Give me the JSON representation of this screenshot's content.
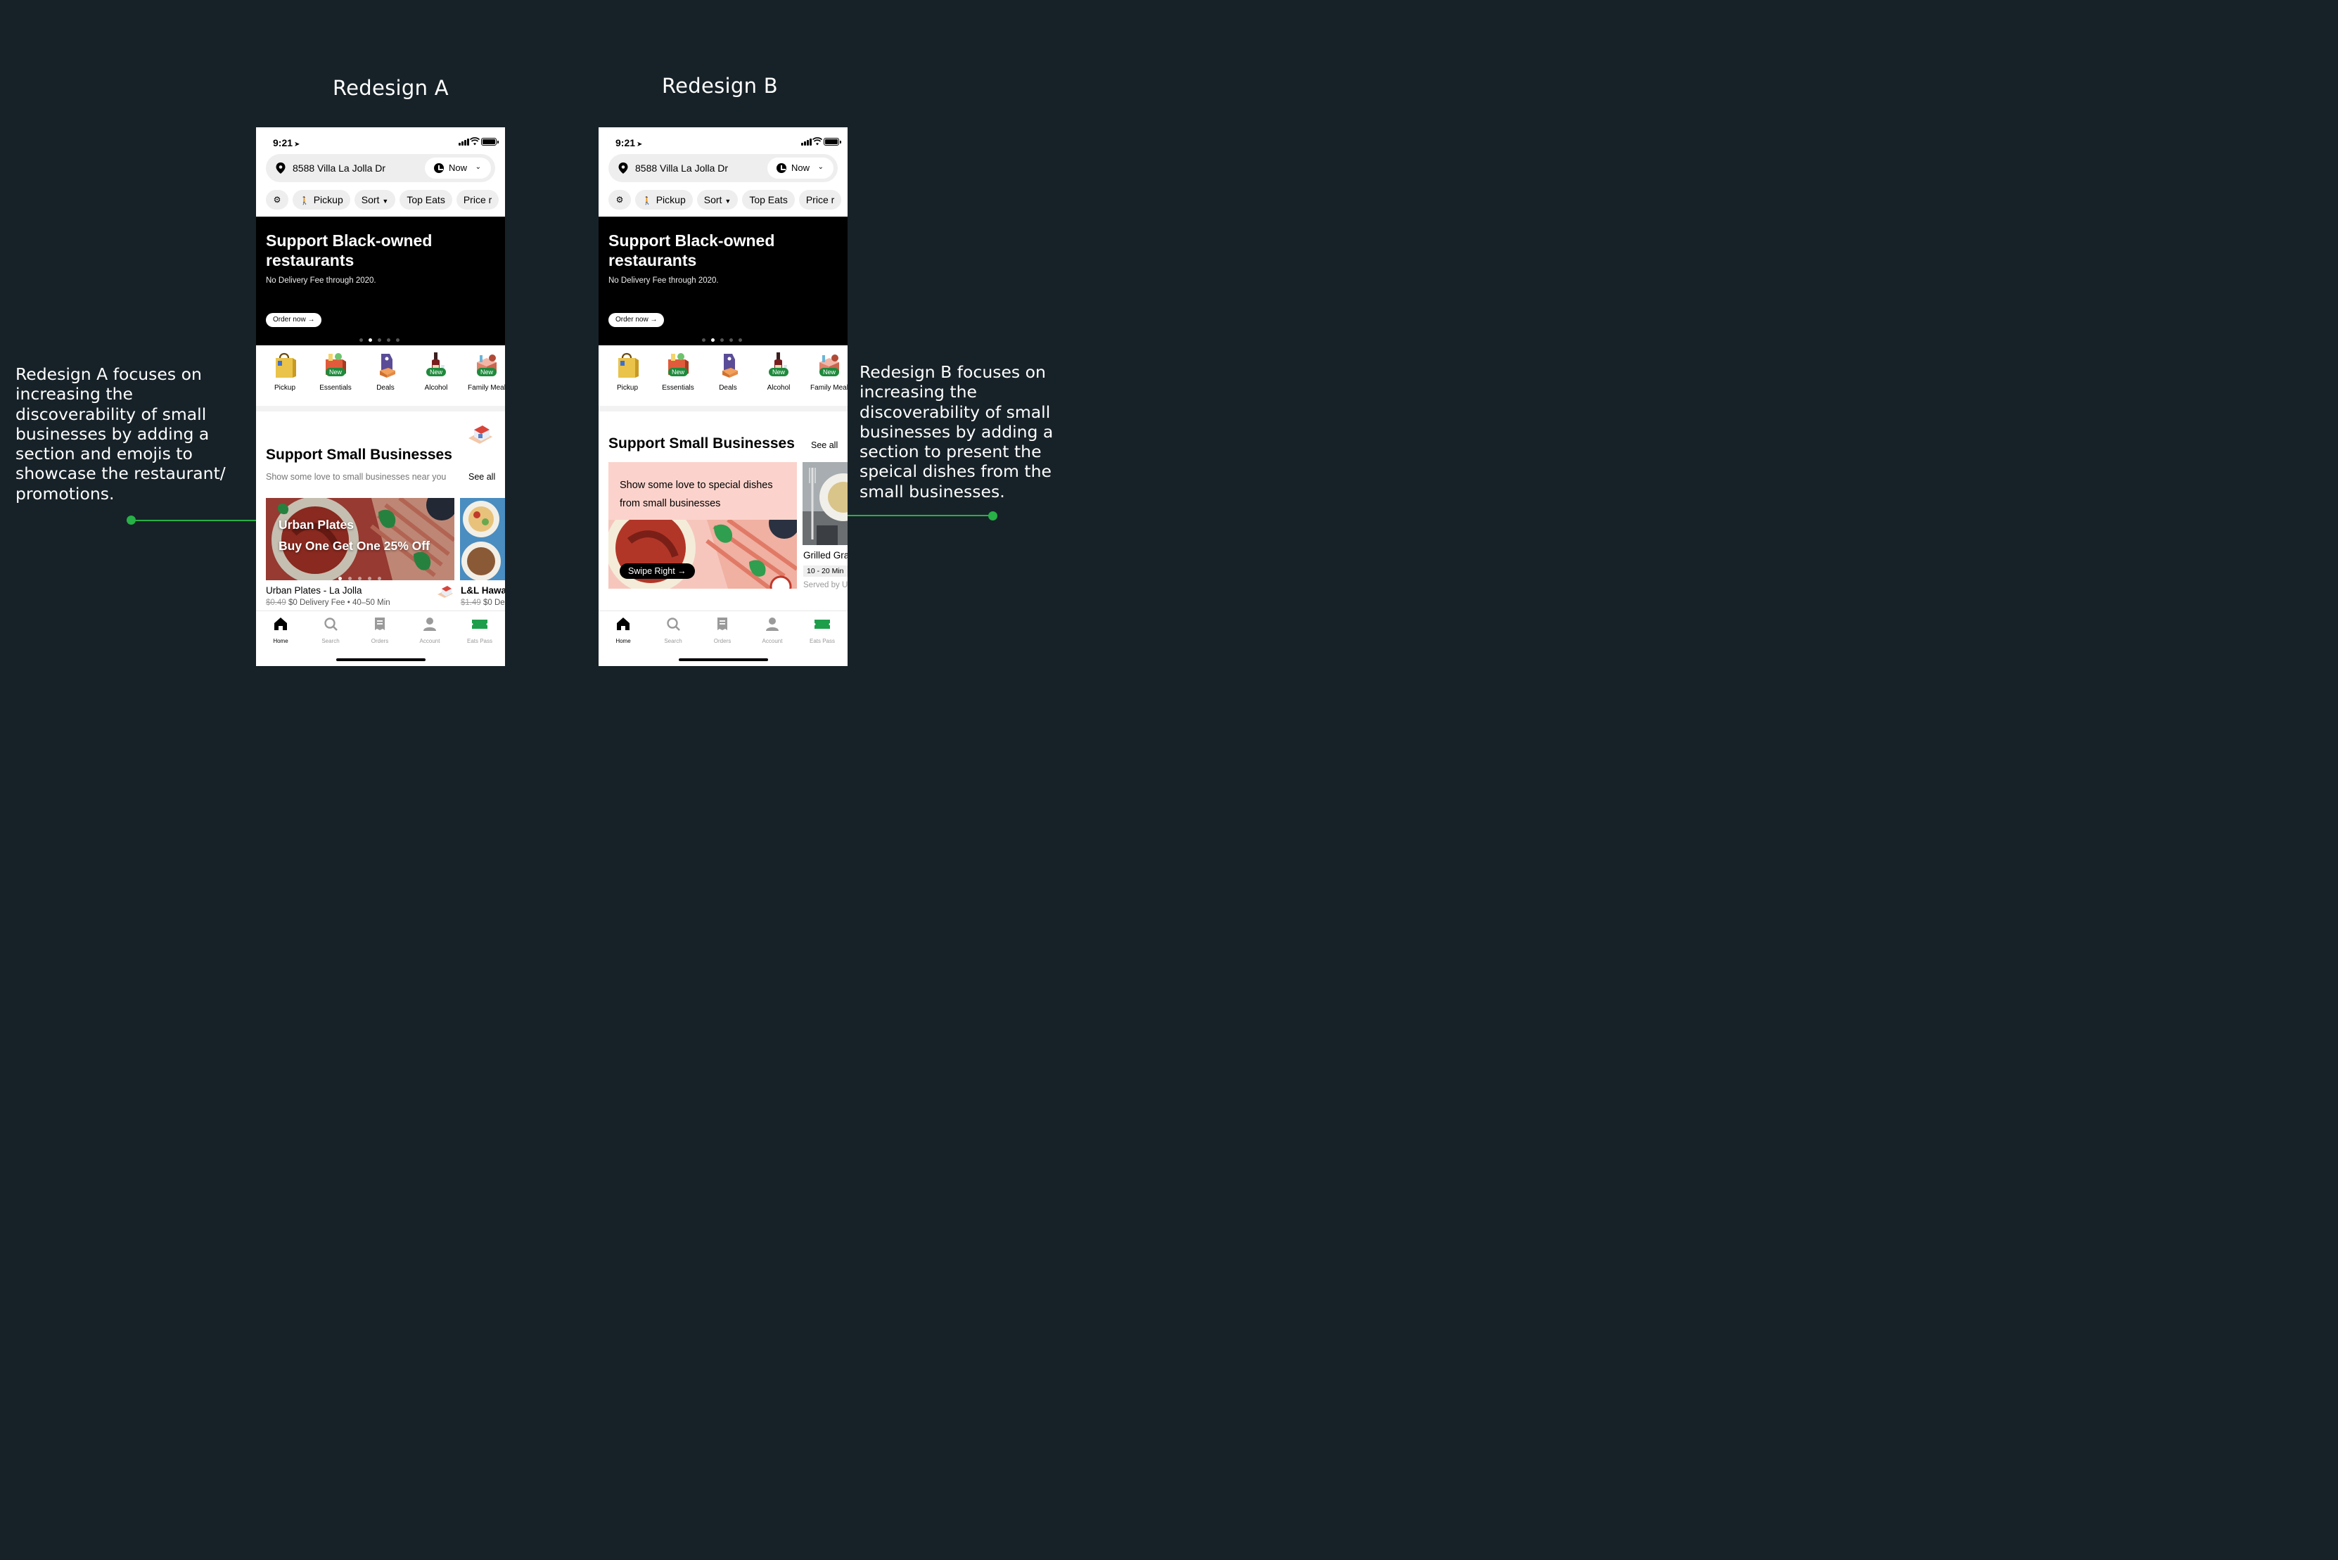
{
  "headings": {
    "a": "Redesign A",
    "b": "Redesign B"
  },
  "notes": {
    "a": "Redesign A focuses on increasing the discoverability of small businesses by adding a section and emojis to showcase the restaurant/ promotions.",
    "b": "Redesign B focuses on increasing the discoverability of small businesses by adding a section to present the speical dishes from the small businesses."
  },
  "accent_color": "#27b146",
  "phone": {
    "time": "9:21",
    "address": "8588 Villa La Jolla Dr",
    "now_label": "Now",
    "filters": {
      "pickup": "Pickup",
      "sort": "Sort",
      "top_eats": "Top Eats",
      "price": "Price r"
    },
    "hero": {
      "title": "Support Black-owned restaurants",
      "subtitle": "No Delivery Fee through 2020.",
      "button": "Order now →"
    },
    "categories": [
      {
        "label": "Pickup",
        "badge": "",
        "icon": "shopping-bag-icon"
      },
      {
        "label": "Essentials",
        "badge": "New",
        "icon": "grocery-bag-icon"
      },
      {
        "label": "Deals",
        "badge": "",
        "icon": "price-tag-icon"
      },
      {
        "label": "Alcohol",
        "badge": "New",
        "icon": "wine-bottle-icon"
      },
      {
        "label": "Family Meal",
        "badge": "New",
        "icon": "family-meal-icon"
      }
    ],
    "tabs": [
      "Home",
      "Search",
      "Orders",
      "Account",
      "Eats Pass"
    ]
  },
  "redesign_a": {
    "section_title": "Support Small Businesses",
    "section_subtitle": "Show some love to small businesses near you",
    "see_all": "See all",
    "card_overlay_line1": "Urban Plates",
    "card_overlay_line2": "Buy One Get One 25% Off",
    "card1": {
      "name": "Urban Plates - La Jolla",
      "old_fee": "$0.49",
      "fee": "$0 Delivery Fee",
      "eta": "40–50 Min"
    },
    "card2": {
      "name": "L&L Hawa",
      "old_fee": "$1.49",
      "fee": "$0 De"
    }
  },
  "redesign_b": {
    "section_title": "Support Small Businesses",
    "see_all": "See all",
    "promo_text": "Show some love to special dishes from small businesses",
    "swipe_label": "Swipe Right →",
    "card2": {
      "name": "Grilled Gra",
      "eta": "10 - 20 Min",
      "served": "Served by U"
    }
  }
}
